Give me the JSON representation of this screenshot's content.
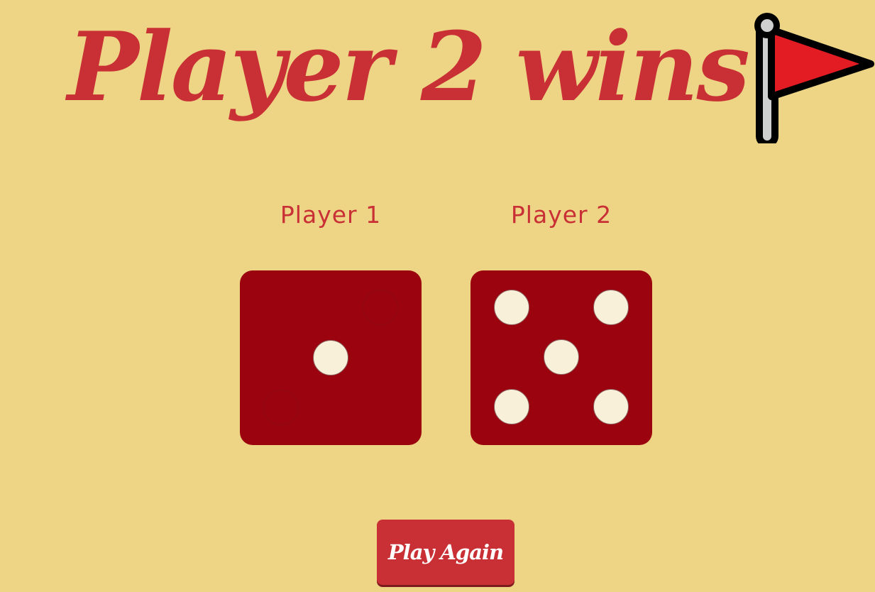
{
  "header": {
    "title": "Player 2 wins",
    "icon": "red-flag-icon"
  },
  "players": [
    {
      "label": "Player 1",
      "die_value": 1
    },
    {
      "label": "Player 2",
      "die_value": 5
    }
  ],
  "actions": {
    "play_again_label": "Play Again"
  },
  "colors": {
    "background": "#EED585",
    "accent": "#C93035",
    "die_face": "#9B040E",
    "pip": "#F9F0D9",
    "flag": "#E31B23"
  }
}
